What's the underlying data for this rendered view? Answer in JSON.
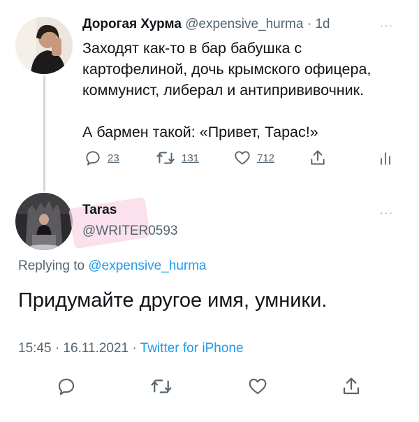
{
  "tweet": {
    "author_name": "Дорогая Хурма",
    "author_handle": "@expensive_hurma",
    "time": "· 1d",
    "more": "···",
    "text": "Заходят как-то в бар бабушка с\nкартофелиной, дочь крымского офицера,\nкоммунист, либерал и антипрививочник.\n\nА бармен такой: «Привет, Тарас!»",
    "actions": {
      "replies": "23",
      "retweets": "131",
      "likes": "712"
    },
    "icons": [
      "reply-icon",
      "retweet-icon",
      "like-icon",
      "share-icon",
      "analytics-icon"
    ]
  },
  "reply": {
    "author_name": "Taras",
    "author_handle": "@WRITER0593",
    "more": "···",
    "replying_prefix": "Replying to",
    "replying_to": "@expensive_hurma",
    "text": "Придумайте другое имя, умники.",
    "timestamp": "15:45 · 16.11.2021 ·",
    "source": "Twitter for iPhone",
    "icons": [
      "reply-icon",
      "retweet-icon",
      "like-icon",
      "share-icon"
    ]
  },
  "colors": {
    "text": "#0f1419",
    "secondary": "#536471",
    "link": "#1d9bf0",
    "thread_line": "#cfd9de",
    "highlight": "#f8d4e2"
  }
}
